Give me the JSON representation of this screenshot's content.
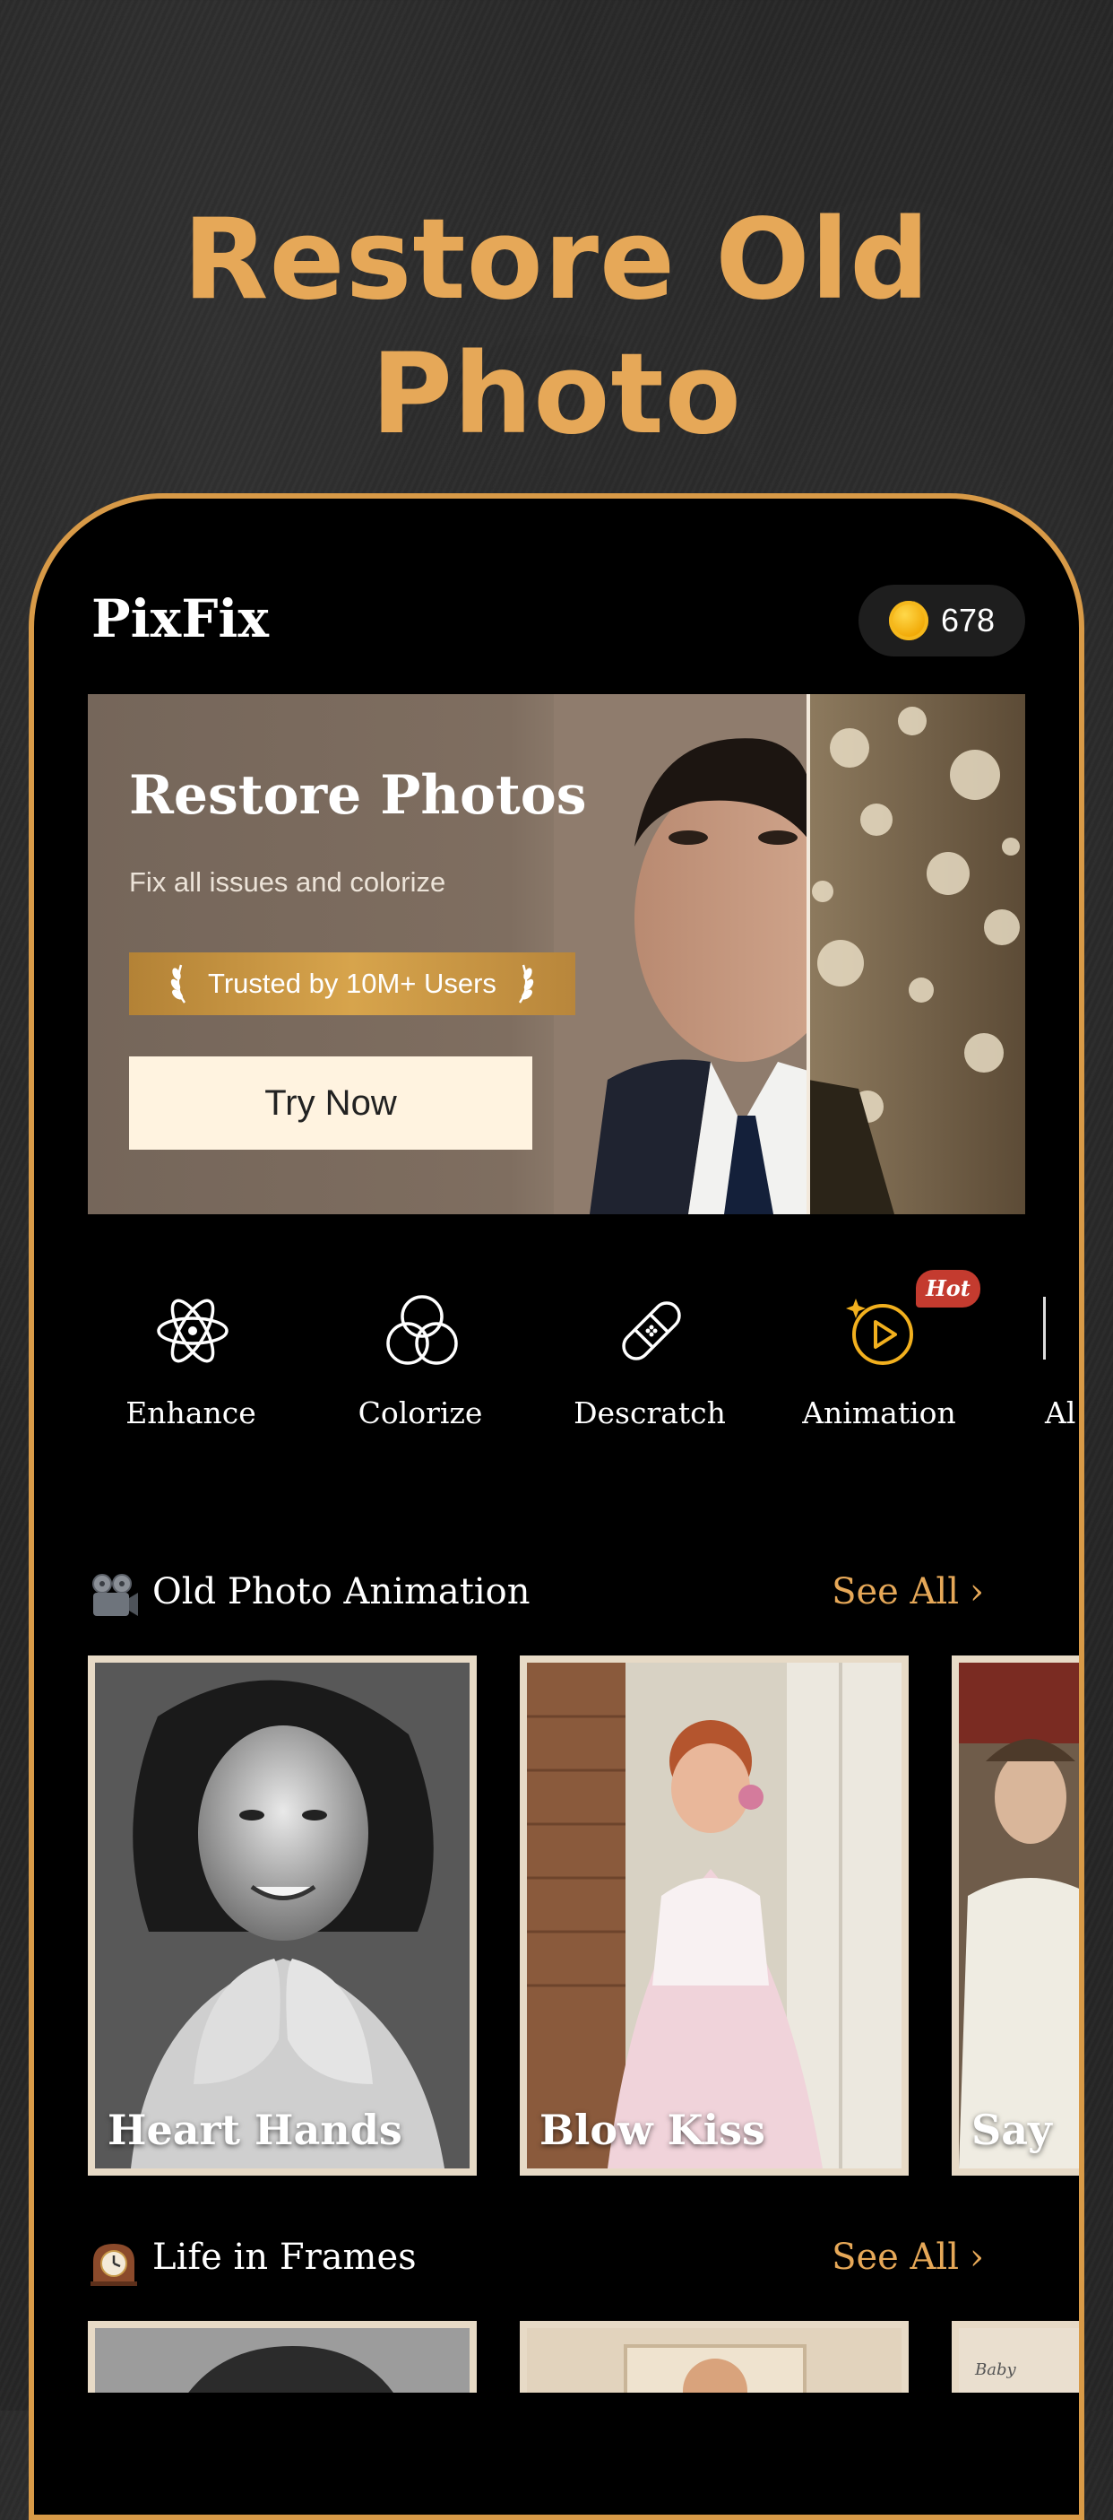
{
  "promo": {
    "headline": "Restore Old Photo"
  },
  "header": {
    "app_name": "PixFix",
    "coins": "678",
    "coin_icon": "gold-coin-icon"
  },
  "banner": {
    "title": "Restore Photos",
    "subtitle": "Fix all issues and colorize",
    "badge": "Trusted by 10M+ Users",
    "button": "Try Now"
  },
  "tools": [
    {
      "label": "Enhance",
      "icon": "atom-icon"
    },
    {
      "label": "Colorize",
      "icon": "color-circles-icon"
    },
    {
      "label": "Descratch",
      "icon": "bandage-icon"
    },
    {
      "label": "Animation",
      "icon": "play-sparkle-icon",
      "badge": "Hot"
    },
    {
      "label": "Al"
    }
  ],
  "sections": {
    "animation": {
      "title": "Old Photo Animation",
      "see_all": "See All",
      "icon": "film-projector-icon",
      "cards": [
        "Heart Hands",
        "Blow Kiss",
        "Say"
      ]
    },
    "frames": {
      "title": "Life in Frames",
      "see_all": "See All",
      "icon": "mantel-clock-icon",
      "cards": [
        "",
        "",
        "Baby"
      ]
    }
  },
  "colors": {
    "accent": "#E6A858",
    "background": "#000000",
    "hot": "#C43B2F",
    "button_bg": "#FFF3E0"
  }
}
